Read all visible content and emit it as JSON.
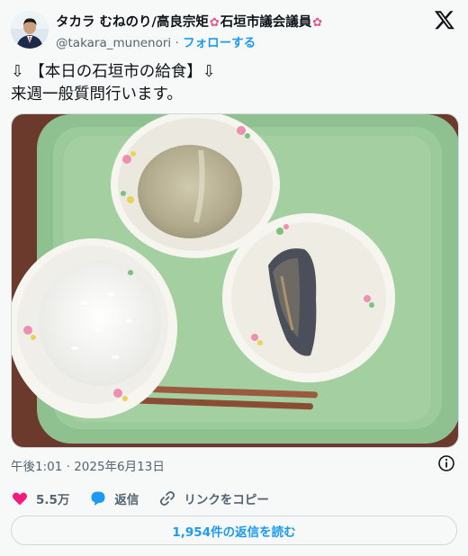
{
  "author": {
    "display_name_part1": "タカラ むねのり/高良宗矩",
    "display_name_part2": "石垣市議会議員",
    "handle": "@takara_munenori",
    "separator": "·",
    "follow_label": "フォローする"
  },
  "tweet": {
    "line1": "⇩ 【本日の石垣市の給食】⇩",
    "line2": "来週一般質問行います。"
  },
  "meta": {
    "timestamp": "午後1:01 · 2025年6月13日"
  },
  "actions": {
    "likes_count": "5.5万",
    "reply_label": "返信",
    "copy_link_label": "リンクをコピー"
  },
  "replies_button": "1,954件の返信を読む",
  "colors": {
    "accent": "#1d9bf0",
    "like": "#f91880",
    "tray": "#8ec38e"
  }
}
